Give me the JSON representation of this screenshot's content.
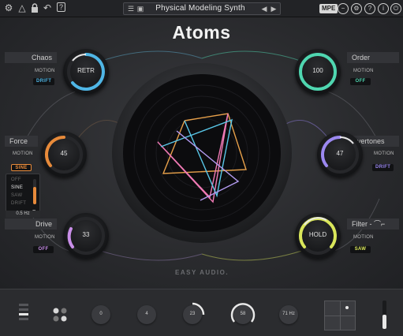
{
  "toolbar": {
    "icons": [
      "settings-gear-icon",
      "warning-triangle-icon",
      "lock-icon",
      "undo-arrow-icon",
      "help-question-icon"
    ],
    "preset_name": "Physical Modeling Synth",
    "mpe_label": "MPE",
    "right_icons": [
      "minus-circle-icon",
      "gear-circle-icon",
      "question-circle-icon",
      "info-circle-icon",
      "power-circle-icon"
    ]
  },
  "title": "Atoms",
  "brand": "EASY AUDIO.",
  "motion_label": "MOTION",
  "params": {
    "chaos": {
      "label": "Chaos",
      "knob_value": "RETR",
      "motion": "DRIFT",
      "color": "#4fb6e6"
    },
    "force": {
      "label": "Force",
      "knob_value": "45",
      "motion": "SINE",
      "color": "#e78a3a"
    },
    "drive": {
      "label": "Drive",
      "knob_value": "33",
      "motion": "OFF",
      "color": "#c98ee8"
    },
    "order": {
      "label": "Order",
      "knob_value": "100",
      "motion": "OFF",
      "color": "#4fd6b0"
    },
    "overtones": {
      "label": "Overtones",
      "knob_value": "47",
      "motion": "DRIFT",
      "color": "#9b88f0"
    },
    "filter": {
      "label": "Filter - ",
      "knob_value": "HOLD",
      "motion": "SAW",
      "color": "#d9e65a"
    }
  },
  "lfo_popup": {
    "options": [
      "OFF",
      "SINE",
      "SAW",
      "DRIFT"
    ],
    "selected": "SINE",
    "footer_f": "F",
    "rate": "0.5 Hz"
  },
  "bottom": {
    "knobs": [
      {
        "value": "0"
      },
      {
        "value": "4"
      },
      {
        "value": "23"
      },
      {
        "value": "58"
      },
      {
        "value": "71 Hz"
      }
    ]
  }
}
